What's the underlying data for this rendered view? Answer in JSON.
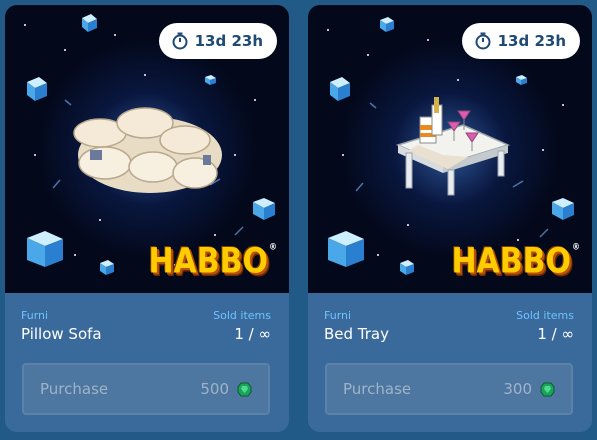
{
  "cards": [
    {
      "timer": "13d 23h",
      "brand": "HABBO",
      "brand_mark": "®",
      "type_label": "Furni",
      "name": "Pillow Sofa",
      "sold_label": "Sold items",
      "sold_count": "1 / ∞",
      "purchase_label": "Purchase",
      "price": "500",
      "currency_icon": "emerald-gem-icon"
    },
    {
      "timer": "13d 23h",
      "brand": "HABBO",
      "brand_mark": "®",
      "type_label": "Furni",
      "name": "Bed Tray",
      "sold_label": "Sold items",
      "sold_count": "1 / ∞",
      "purchase_label": "Purchase",
      "price": "300",
      "currency_icon": "emerald-gem-icon"
    }
  ],
  "colors": {
    "page_bg": "#215a86",
    "card_bg": "#3a6a9b",
    "accent_label": "#6fc3ff",
    "timer_text": "#1f4a73",
    "gem": "#1aa35a"
  }
}
